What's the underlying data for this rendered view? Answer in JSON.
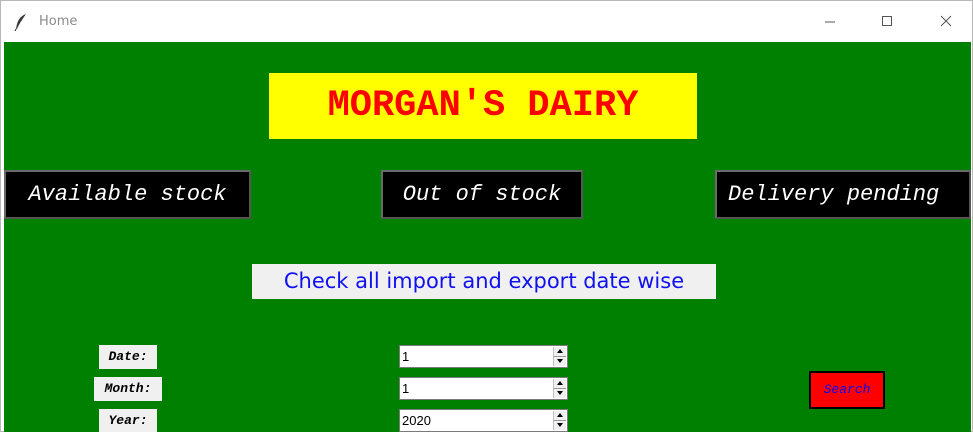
{
  "window": {
    "title": "Home",
    "icon": "feather-icon",
    "controls": [
      "minimize-icon",
      "maximize-icon",
      "close-icon"
    ]
  },
  "header": {
    "brand": "MORGAN'S DAIRY"
  },
  "nav": {
    "available_stock": "Available stock",
    "out_of_stock": "Out of stock",
    "delivery_pending": "Delivery pending"
  },
  "subtitle": "Check all import and export date wise",
  "form": {
    "date_label": "Date:",
    "date_value": "1",
    "month_label": "Month:",
    "month_value": "1",
    "year_label": "Year:",
    "year_value": "2020",
    "search_label": "Search"
  },
  "colors": {
    "background": "#008000",
    "brand_bg": "#ffff00",
    "brand_text": "#ff0000",
    "nav_bg": "#000000",
    "nav_text": "#ffffff",
    "subtitle_text": "#1010f0",
    "search_bg": "#ff0000",
    "search_text": "#0000ff"
  }
}
